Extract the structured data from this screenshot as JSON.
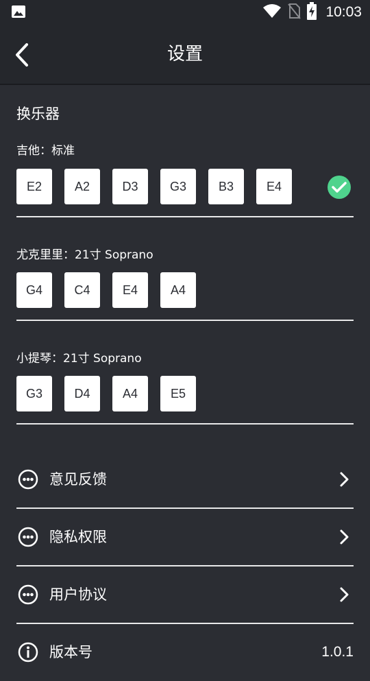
{
  "status_bar": {
    "time": "10:03",
    "icons": [
      "image-icon",
      "wifi-icon",
      "no-sim-icon",
      "battery-charging-icon"
    ]
  },
  "app_bar": {
    "title": "设置",
    "back_icon": "chevron-left-icon"
  },
  "tuning": {
    "section_title": "换乐器",
    "instruments": [
      {
        "label": "吉他：标准",
        "notes": [
          "E2",
          "A2",
          "D3",
          "G3",
          "B3",
          "E4"
        ],
        "selected": true
      },
      {
        "label": "尤克里里：21寸 Soprano",
        "notes": [
          "G4",
          "C4",
          "E4",
          "A4"
        ],
        "selected": false
      },
      {
        "label": "小提琴：21寸 Soprano",
        "notes": [
          "G3",
          "D4",
          "A4",
          "E5"
        ],
        "selected": false
      }
    ]
  },
  "menu": {
    "items": [
      {
        "label": "意见反馈",
        "icon": "more-circle-icon"
      },
      {
        "label": "隐私权限",
        "icon": "more-circle-icon"
      },
      {
        "label": "用户协议",
        "icon": "more-circle-icon"
      }
    ],
    "version": {
      "label": "版本号",
      "value": "1.0.1",
      "icon": "info-icon"
    }
  },
  "colors": {
    "background": "#2b2d33",
    "bar": "#25272c",
    "selected_check": "#4fd38d",
    "note_bg": "#ffffff"
  }
}
